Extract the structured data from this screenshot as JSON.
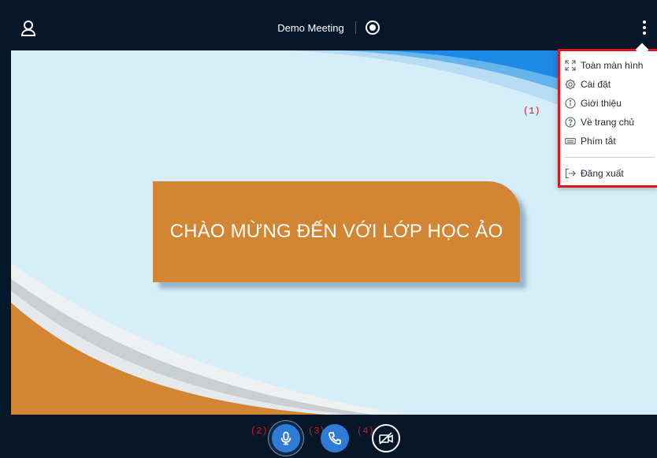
{
  "topbar": {
    "meeting_title": "Demo Meeting",
    "icons": {
      "user": "user-icon",
      "record": "record-icon",
      "more": "more-vertical-icon"
    }
  },
  "menu": {
    "items": [
      {
        "label": "Toàn màn hình",
        "icon": "fullscreen-icon"
      },
      {
        "label": "Cài đặt",
        "icon": "gear-icon"
      },
      {
        "label": "Giới thiệu",
        "icon": "info-icon"
      },
      {
        "label": "Về trang chủ",
        "icon": "help-icon"
      },
      {
        "label": "Phím tắt",
        "icon": "keyboard-icon"
      },
      {
        "label": "Đăng xuất",
        "icon": "logout-icon"
      }
    ]
  },
  "slide": {
    "banner_text": "CHÀO MỪNG ĐẾN VỚI LỚP HỌC ẢO",
    "colors": {
      "background": "#d6eef9",
      "banner": "#d28532",
      "accent_blue": "#1e88e5"
    }
  },
  "annotations": {
    "menu_marker": "(1)",
    "mic_marker": "(2)",
    "phone_marker": "(3)",
    "camera_marker": "(4)"
  },
  "controls": {
    "mic": "microphone-icon",
    "phone": "phone-icon",
    "camera": "camera-off-icon"
  }
}
